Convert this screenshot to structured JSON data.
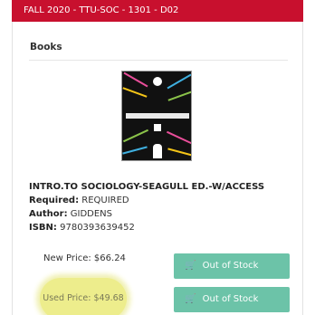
{
  "course": {
    "header": "FALL 2020 - TTU-SOC - 1301 - D02"
  },
  "section": {
    "title": "Books"
  },
  "book": {
    "title": "INTRO.TO SOCIOLOGY-SEAGULL ED.-W/ACCESS",
    "required_label": "Required",
    "required_value": "REQUIRED",
    "author_label": "Author",
    "author_value": "GIDDENS",
    "isbn_label": "ISBN",
    "isbn_value": "9780393639452"
  },
  "pricing": {
    "new_price": "New Price: $66.24",
    "used_price": "Used Price: $49.68",
    "new_status": "Out of Stock",
    "used_status": "Out of Stock"
  },
  "icons": {
    "cart": "cart-icon"
  },
  "colors": {
    "header_bg": "#c8102e",
    "button_bg": "#6cc3a8",
    "used_highlight": "#eded8c"
  }
}
